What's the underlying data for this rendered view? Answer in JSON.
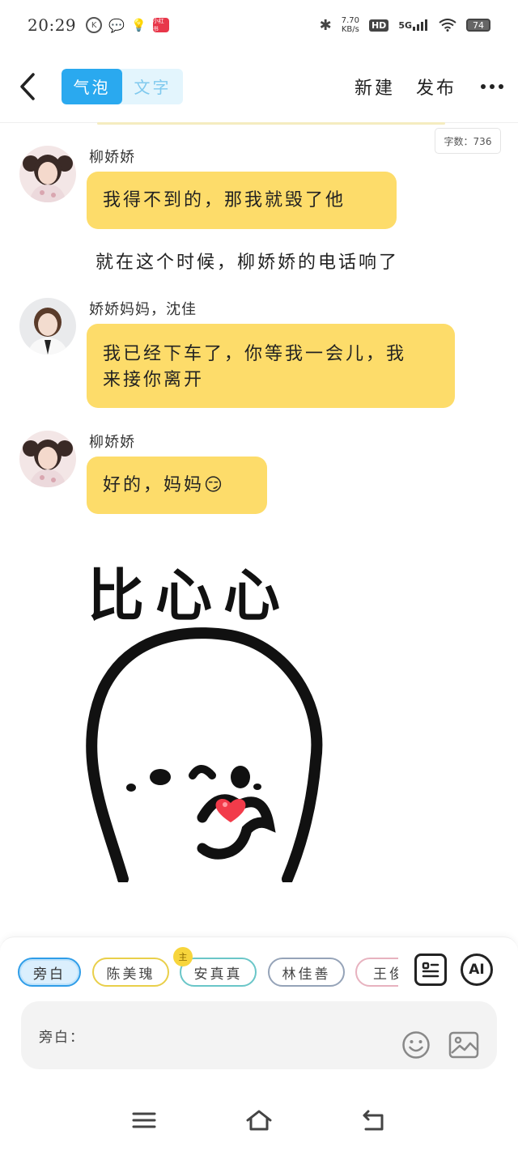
{
  "status_bar": {
    "time": "20:29",
    "speed_value": "7.70",
    "speed_unit": "KB/s",
    "hd": "HD",
    "network": "5G",
    "battery": "74",
    "app_badge": "小红书"
  },
  "nav": {
    "tab_bubble": "气泡",
    "tab_text": "文字",
    "new_label": "新建",
    "publish_label": "发布"
  },
  "word_count": "字数：736",
  "messages": [
    {
      "sender": "柳娇娇",
      "text": "我得不到的，那我就毁了他"
    },
    {
      "sender": "娇娇妈妈，沈佳",
      "line1": "我已经下车了，你等我一会儿，我",
      "line2": "来接你离开"
    },
    {
      "sender": "柳娇娇",
      "text": "好的，妈妈😏"
    }
  ],
  "narration": "就在这个时候，柳娇娇的电话响了",
  "sticker_text": "比心心",
  "characters": [
    "旁白",
    "陈美瑰",
    "安真真",
    "林佳善",
    "王俊"
  ],
  "main_badge": "主",
  "ai_label": "AI",
  "input": {
    "label": "旁白："
  },
  "colors": {
    "accent": "#2aa9ef",
    "bubble": "#fddc6a",
    "chip_chen": "#e9cf4a",
    "chip_an": "#6ac6c8",
    "chip_lin": "#95a3b8",
    "chip_wang": "#e7b2bf"
  },
  "icons": [
    "back-arrow-icon",
    "more-icon",
    "contact-card-icon",
    "smile-icon",
    "image-icon",
    "menu-icon",
    "home-icon",
    "back-icon"
  ]
}
